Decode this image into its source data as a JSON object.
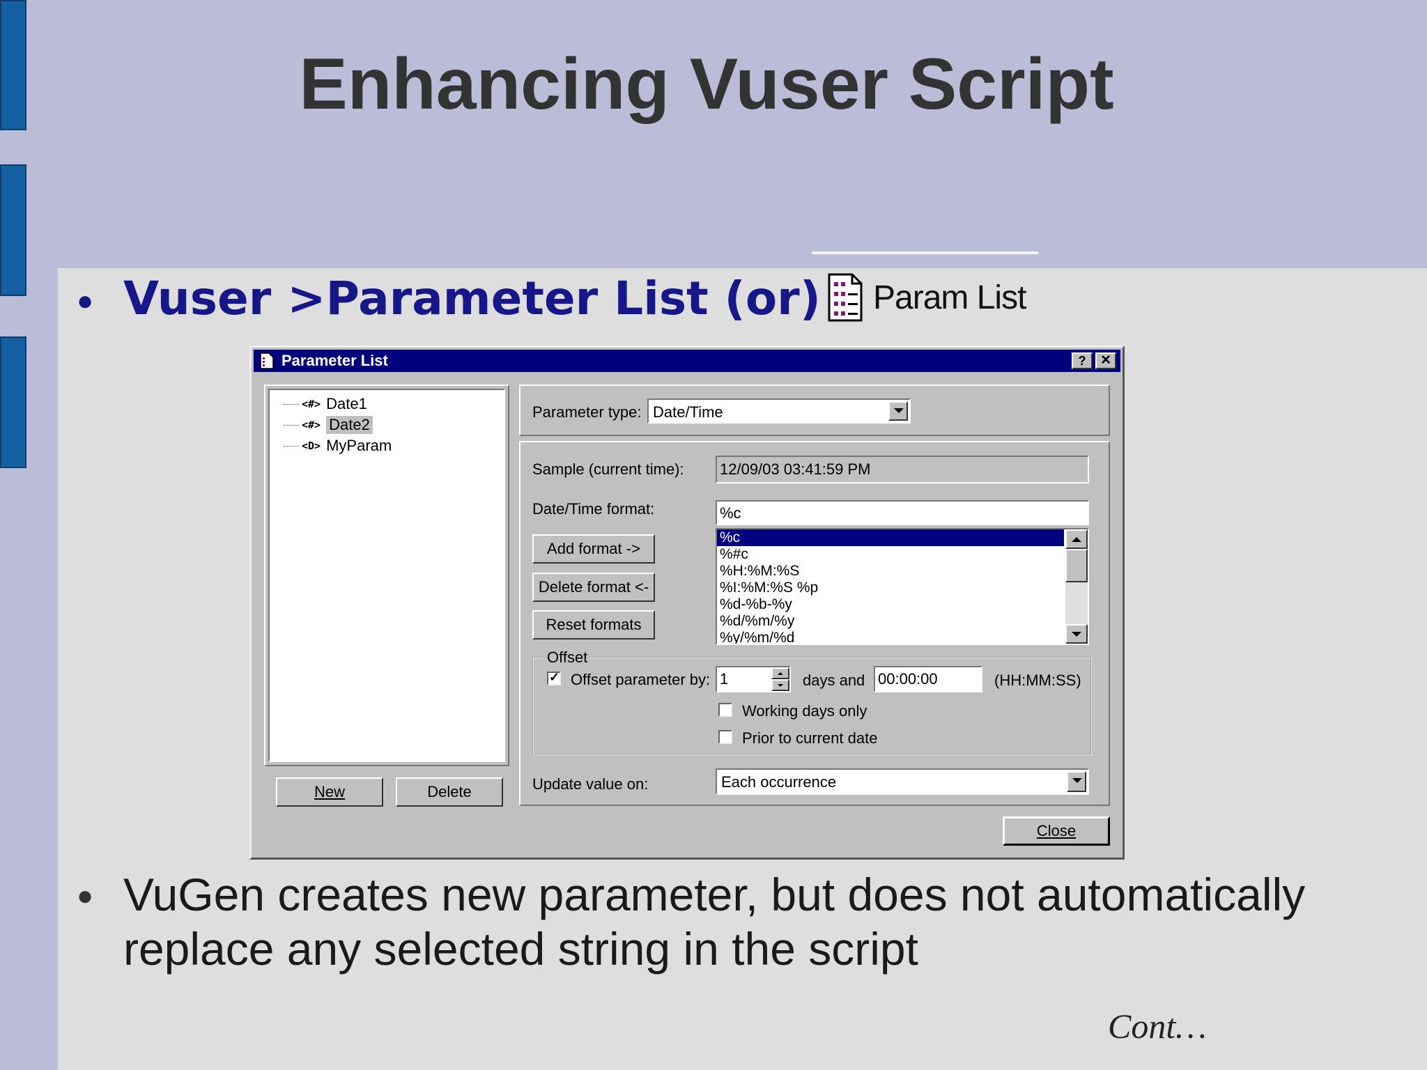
{
  "slide": {
    "title": "Enhancing Vuser Script",
    "bullet1": "Vuser >Parameter List  (or)",
    "param_button_label": "Param List",
    "bullet2": "VuGen creates new parameter, but does not automatically replace any selected string in the script",
    "cont": "Cont…"
  },
  "dialog": {
    "title": "Parameter List",
    "help_button": "?",
    "close_x": "×",
    "tree": [
      {
        "icon": "<#>",
        "label": "Date1"
      },
      {
        "icon": "<#>",
        "label": "Date2"
      },
      {
        "icon": "<D>",
        "label": "MyParam"
      }
    ],
    "new_button": "New",
    "delete_button": "Delete",
    "param_type_label": "Parameter type:",
    "param_type_value": "Date/Time",
    "sample_label": "Sample (current time):",
    "sample_value": "12/09/03 03:41:59 PM",
    "format_label": "Date/Time format:",
    "format_value": "%c",
    "add_format": "Add format ->",
    "delete_format": "Delete format <-",
    "reset_formats": "Reset formats",
    "formats": [
      "%c",
      "%#c",
      "%H:%M:%S",
      "%I:%M:%S %p",
      "%d-%b-%y",
      "%d/%m/%y",
      "%y/%m/%d"
    ],
    "offset_group": "Offset",
    "offset_label": "Offset parameter by:",
    "offset_value": "1",
    "days_and": "days and",
    "offset_time": "00:00:00",
    "time_format": "(HH:MM:SS)",
    "working_days": "Working days only",
    "prior_date": "Prior to current date",
    "update_label": "Update value on:",
    "update_value": "Each occurrence",
    "close_button": "Close"
  },
  "colors": {
    "bullet_blue": "#17178a",
    "titlebar": "#00007f",
    "accent_tab": "#1560a2"
  }
}
